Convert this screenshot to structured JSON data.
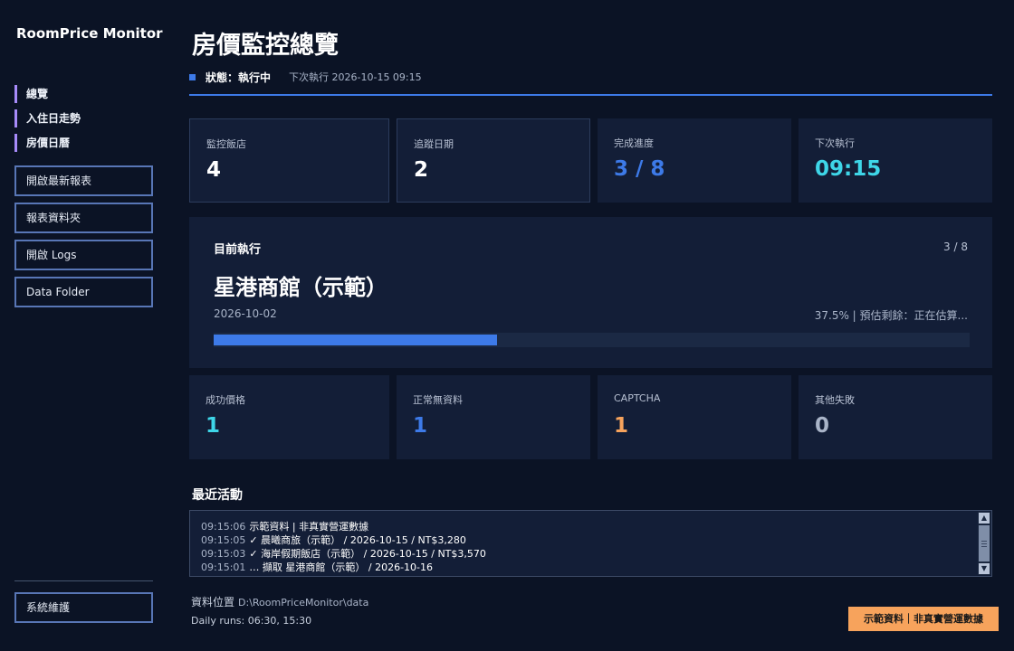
{
  "app": {
    "title": "RoomPrice Monitor"
  },
  "sidebar": {
    "nav": [
      {
        "label": "總覽"
      },
      {
        "label": "入住日走勢"
      },
      {
        "label": "房價日曆"
      }
    ],
    "buttons": [
      {
        "label": "開啟最新報表"
      },
      {
        "label": "報表資料夾"
      },
      {
        "label": "開啟 Logs"
      },
      {
        "label": "Data Folder"
      }
    ],
    "maintenance_label": "系統維護"
  },
  "header": {
    "title": "房價監控總覽",
    "status": "狀態：執行中",
    "next_run": "下次執行 2026-10-15 09:15"
  },
  "summary_cards": [
    {
      "label": "監控飯店",
      "value": "4"
    },
    {
      "label": "追蹤日期",
      "value": "2"
    },
    {
      "label": "完成進度",
      "value": "3 / 8"
    },
    {
      "label": "下次執行",
      "value": "09:15"
    }
  ],
  "current": {
    "label": "目前執行",
    "counter": "3 / 8",
    "hotel": "星港商館（示範）",
    "date": "2026-10-02",
    "progress_text": "37.5% | 預估剩餘：正在估算...",
    "progress_fraction": 0.375
  },
  "result_cards": [
    {
      "label": "成功價格",
      "value": "1"
    },
    {
      "label": "正常無資料",
      "value": "1"
    },
    {
      "label": "CAPTCHA",
      "value": "1"
    },
    {
      "label": "其他失敗",
      "value": "0"
    }
  ],
  "activity": {
    "title": "最近活動",
    "lines": [
      {
        "time": "09:15:06",
        "text": "示範資料 | 非真實營運數據"
      },
      {
        "time": "09:15:05",
        "text": "✓ 晨曦商旅（示範） / 2026-10-15 / NT$3,280"
      },
      {
        "time": "09:15:03",
        "text": "✓ 海岸假期飯店（示範） / 2026-10-15 / NT$3,570"
      },
      {
        "time": "09:15:01",
        "text": "… 擷取 星港商館（示範） / 2026-10-16"
      }
    ]
  },
  "footer": {
    "data_label": "資料位置",
    "data_path": "D:\\RoomPriceMonitor\\data",
    "runs": "Daily runs: 06:30, 15:30",
    "demo_badge": "示範資料｜非真實營運數據"
  },
  "colors": {
    "background": "#0b1325",
    "panel": "#131e37",
    "accent_blue": "#3d7ae8",
    "accent_purple": "#a78bfa",
    "cyan": "#3ed6e8",
    "orange": "#f7a35c",
    "gray_value": "#a9b4c8"
  }
}
